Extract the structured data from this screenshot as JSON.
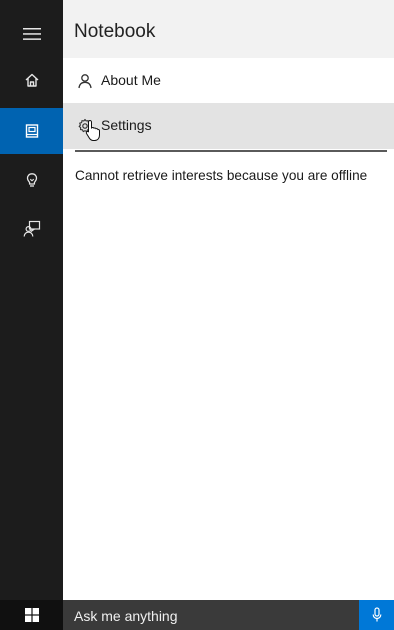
{
  "app": {
    "accent_color": "#0063b1",
    "rail_color": "#1c1c1c"
  },
  "rail": {
    "items": [
      {
        "icon": "hamburger-menu-icon",
        "active": false
      },
      {
        "icon": "home-icon",
        "active": false
      },
      {
        "icon": "notebook-icon",
        "active": true
      },
      {
        "icon": "reminders-lightbulb-icon",
        "active": false
      },
      {
        "icon": "feedback-icon",
        "active": false
      }
    ]
  },
  "notebook": {
    "title": "Notebook",
    "items": [
      {
        "label": "About Me",
        "icon": "person-icon",
        "selected": false
      },
      {
        "label": "Settings",
        "icon": "gear-icon",
        "selected": true
      }
    ],
    "offline_message": "Cannot retrieve interests because you are offline"
  },
  "taskbar": {
    "start_icon": "windows-logo-icon",
    "search_placeholder": "Ask me anything",
    "mic_icon": "microphone-icon",
    "mic_color": "#0078d7"
  }
}
